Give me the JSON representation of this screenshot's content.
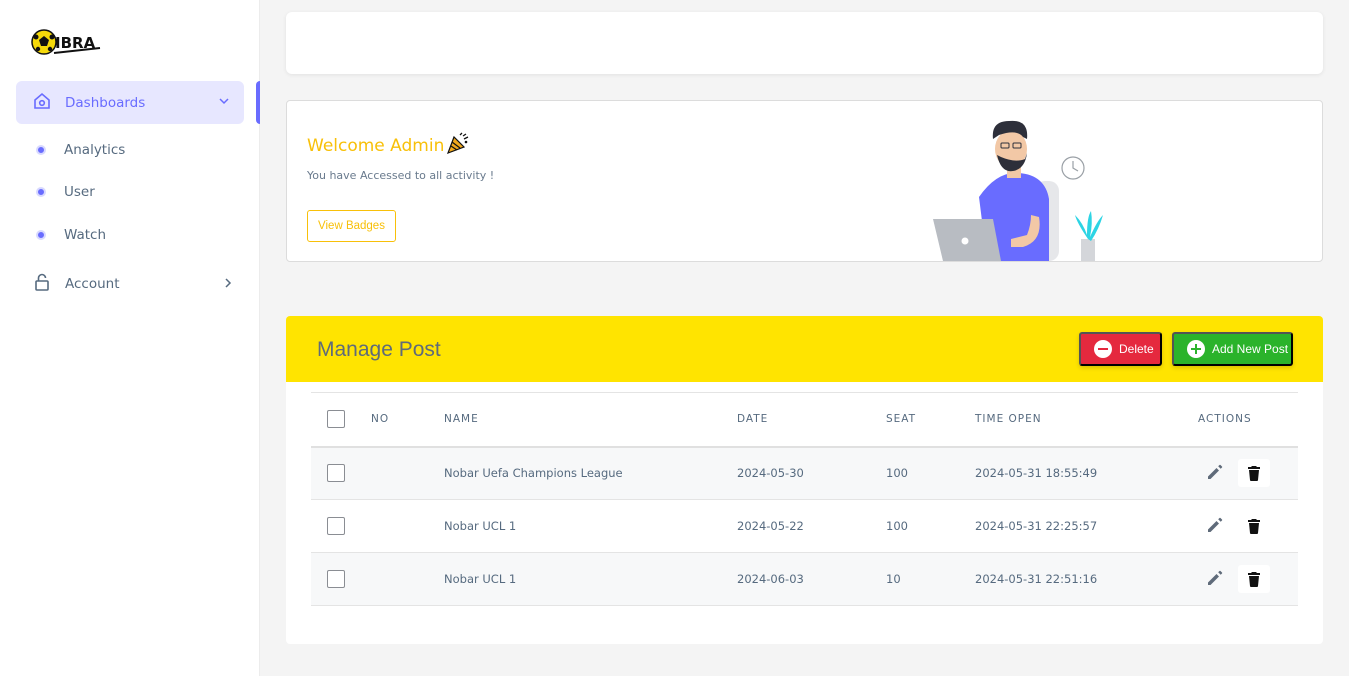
{
  "brand": {
    "name": "IBRA"
  },
  "sidebar": {
    "dashboards_label": "Dashboards",
    "sub_items": [
      {
        "label": "Analytics"
      },
      {
        "label": "User"
      },
      {
        "label": "Watch"
      }
    ],
    "account_label": "Account"
  },
  "welcome": {
    "title": "Welcome Admin",
    "subtitle": "You have Accessed to all activity !",
    "button_label": "View Badges"
  },
  "manage_post": {
    "title": "Manage Post",
    "delete_label": "Delete",
    "add_label": "Add New Post",
    "columns": [
      "NO",
      "NAME",
      "DATE",
      "SEAT",
      "TIME OPEN",
      "ACTIONS"
    ],
    "rows": [
      {
        "no": "",
        "name": "Nobar Uefa Champions League",
        "date": "2024-05-30",
        "seat": "100",
        "time_open": "2024-05-31 18:55:49"
      },
      {
        "no": "",
        "name": "Nobar UCL 1",
        "date": "2024-05-22",
        "seat": "100",
        "time_open": "2024-05-31 22:25:57"
      },
      {
        "no": "",
        "name": "Nobar UCL 1",
        "date": "2024-06-03",
        "seat": "10",
        "time_open": "2024-05-31 22:51:16"
      }
    ]
  },
  "colors": {
    "accent": "#696cff",
    "yellow_header": "#ffe400",
    "welcome_text": "#f8c009",
    "delete": "#e5293e",
    "add": "#2bb32b"
  },
  "icons": {
    "home": "home-icon",
    "lock": "lock-icon",
    "edit": "pencil-icon",
    "trash": "trash-icon",
    "party": "party-popper-icon"
  }
}
